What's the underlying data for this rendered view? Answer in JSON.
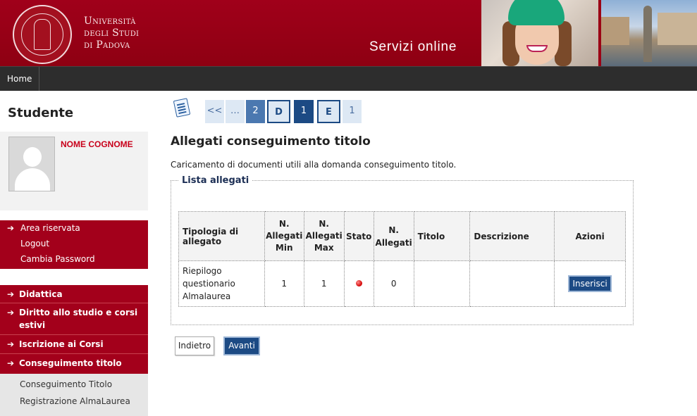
{
  "header": {
    "university_line1": "Università",
    "university_line2": "degli Studi",
    "university_line3": "di Padova",
    "site_title": "Servizi online",
    "accent_color": "#9b0014"
  },
  "nav": {
    "home": "Home"
  },
  "sidebar": {
    "section_title": "Studente",
    "user_name": "NOME COGNOME",
    "area": {
      "title": "Area riservata",
      "items": [
        "Logout",
        "Cambia Password"
      ]
    },
    "menu": [
      "Didattica",
      "Diritto allo studio e corsi",
      "estivi",
      "Iscrizione ai Corsi",
      "Conseguimento titolo"
    ],
    "submenu": [
      "Conseguimento Titolo",
      "Registrazione AlmaLaurea"
    ]
  },
  "pager": {
    "first": "<<",
    "ellipsis": "…",
    "p2": "2",
    "pD": "D",
    "p1": "1",
    "pE": "E",
    "last": "1"
  },
  "page": {
    "title": "Allegati conseguimento titolo",
    "description": "Caricamento di documenti utili alla domanda conseguimento titolo.",
    "legend": "Lista allegati"
  },
  "table": {
    "headers": {
      "tipologia_1": "Tipologia di",
      "tipologia_2": "allegato",
      "min_1": "N.",
      "min_2": "Allegati",
      "min_3": "Min",
      "max_1": "N.",
      "max_2": "Allegati",
      "max_3": "Max",
      "stato": "Stato",
      "nall_1": "N.",
      "nall_2": "Allegati",
      "titolo": "Titolo",
      "descrizione": "Descrizione",
      "azioni": "Azioni"
    },
    "rows": [
      {
        "tipologia_1": "Riepilogo",
        "tipologia_2": "questionario",
        "tipologia_3": "Almalaurea",
        "min": "1",
        "max": "1",
        "stato_color": "#d10000",
        "n_allegati": "0",
        "titolo": "",
        "descrizione": "",
        "azione": "Inserisci"
      }
    ]
  },
  "buttons": {
    "back": "Indietro",
    "next": "Avanti"
  }
}
